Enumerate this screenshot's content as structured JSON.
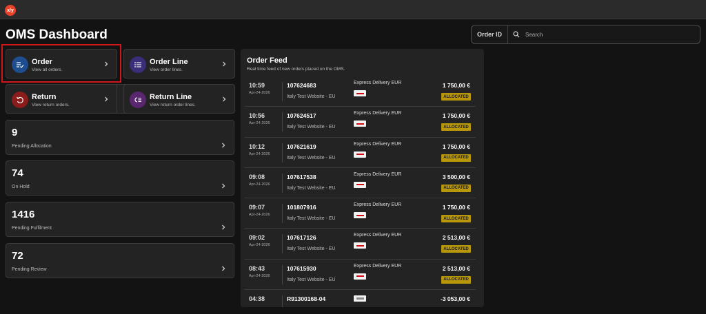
{
  "app": {
    "logo_text": "x/y",
    "title": "OMS Dashboard"
  },
  "search": {
    "select_label": "Order ID",
    "placeholder": "Search",
    "value": ""
  },
  "quick_cards": [
    {
      "title": "Order",
      "subtitle": "View all orders.",
      "icon": "order-list-check-icon",
      "color": "#1e4e8f"
    },
    {
      "title": "Order Line",
      "subtitle": "View order lines.",
      "icon": "list-icon",
      "color": "#3a2d7a"
    },
    {
      "title": "Return",
      "subtitle": "View return orders.",
      "icon": "return-icon",
      "color": "#8a1c1c"
    },
    {
      "title": "Return Line",
      "subtitle": "View return order lines.",
      "icon": "return-line-icon",
      "color": "#5a2670"
    }
  ],
  "stat_cards": [
    {
      "value": "9",
      "label": "Pending Allocation"
    },
    {
      "value": "74",
      "label": "On Hold"
    },
    {
      "value": "1416",
      "label": "Pending Fulfilment"
    },
    {
      "value": "72",
      "label": "Pending Review"
    }
  ],
  "feed": {
    "title": "Order Feed",
    "subtitle": "Real time feed of new orders placed on the OMS.",
    "rows": [
      {
        "time": "10:59",
        "date": "Apr-24-2026",
        "order_id": "107624683",
        "store": "Italy Test Website - EU",
        "shipping": "Express Delivery EUR",
        "amount": "1 750,00 €",
        "status": "ALLOCATED"
      },
      {
        "time": "10:56",
        "date": "Apr-24-2026",
        "order_id": "107624517",
        "store": "Italy Test Website - EU",
        "shipping": "Express Delivery EUR",
        "amount": "1 750,00 €",
        "status": "ALLOCATED"
      },
      {
        "time": "10:12",
        "date": "Apr-24-2026",
        "order_id": "107621619",
        "store": "Italy Test Website - EU",
        "shipping": "Express Delivery EUR",
        "amount": "1 750,00 €",
        "status": "ALLOCATED"
      },
      {
        "time": "09:08",
        "date": "Apr-24-2026",
        "order_id": "107617538",
        "store": "Italy Test Website - EU",
        "shipping": "Express Delivery EUR",
        "amount": "3 500,00 €",
        "status": "ALLOCATED"
      },
      {
        "time": "09:07",
        "date": "Apr-24-2026",
        "order_id": "101807916",
        "store": "Italy Test Website - EU",
        "shipping": "Express Delivery EUR",
        "amount": "1 750,00 €",
        "status": "ALLOCATED"
      },
      {
        "time": "09:02",
        "date": "Apr-24-2026",
        "order_id": "107617126",
        "store": "Italy Test Website - EU",
        "shipping": "Express Delivery EUR",
        "amount": "2 513,00 €",
        "status": "ALLOCATED"
      },
      {
        "time": "08:43",
        "date": "Apr-24-2026",
        "order_id": "107615930",
        "store": "Italy Test Website - EU",
        "shipping": "Express Delivery EUR",
        "amount": "2 513,00 €",
        "status": "ALLOCATED"
      },
      {
        "time": "04:38",
        "date": "",
        "order_id": "R91300168-04",
        "store": "",
        "shipping": "",
        "amount": "-3 053,00 €",
        "status": ""
      }
    ]
  }
}
